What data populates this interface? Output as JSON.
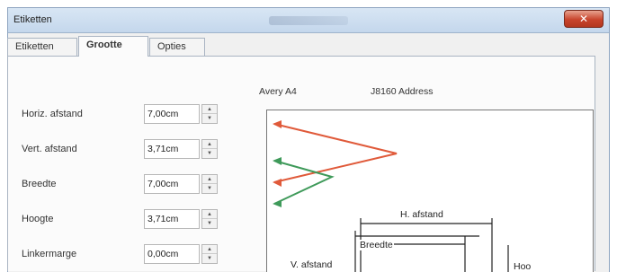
{
  "window": {
    "title": "Etiketten"
  },
  "tabs": [
    "Etiketten",
    "Grootte",
    "Opties"
  ],
  "fields": [
    {
      "label": "Horiz. afstand",
      "value": "7,00cm"
    },
    {
      "label": "Vert. afstand",
      "value": "3,71cm"
    },
    {
      "label": "Breedte",
      "value": "7,00cm"
    },
    {
      "label": "Hoogte",
      "value": "3,71cm"
    },
    {
      "label": "Linkermarge",
      "value": "0,00cm"
    }
  ],
  "preview": {
    "brand": "Avery A4",
    "type": "J8160 Address",
    "labels": {
      "h_distance": "H. afstand",
      "width": "Breedte",
      "v_distance": "V. afstand",
      "height": "Hoo"
    }
  },
  "colors": {
    "arrow_red": "#e05a3a",
    "arrow_green": "#3f9a5a"
  }
}
